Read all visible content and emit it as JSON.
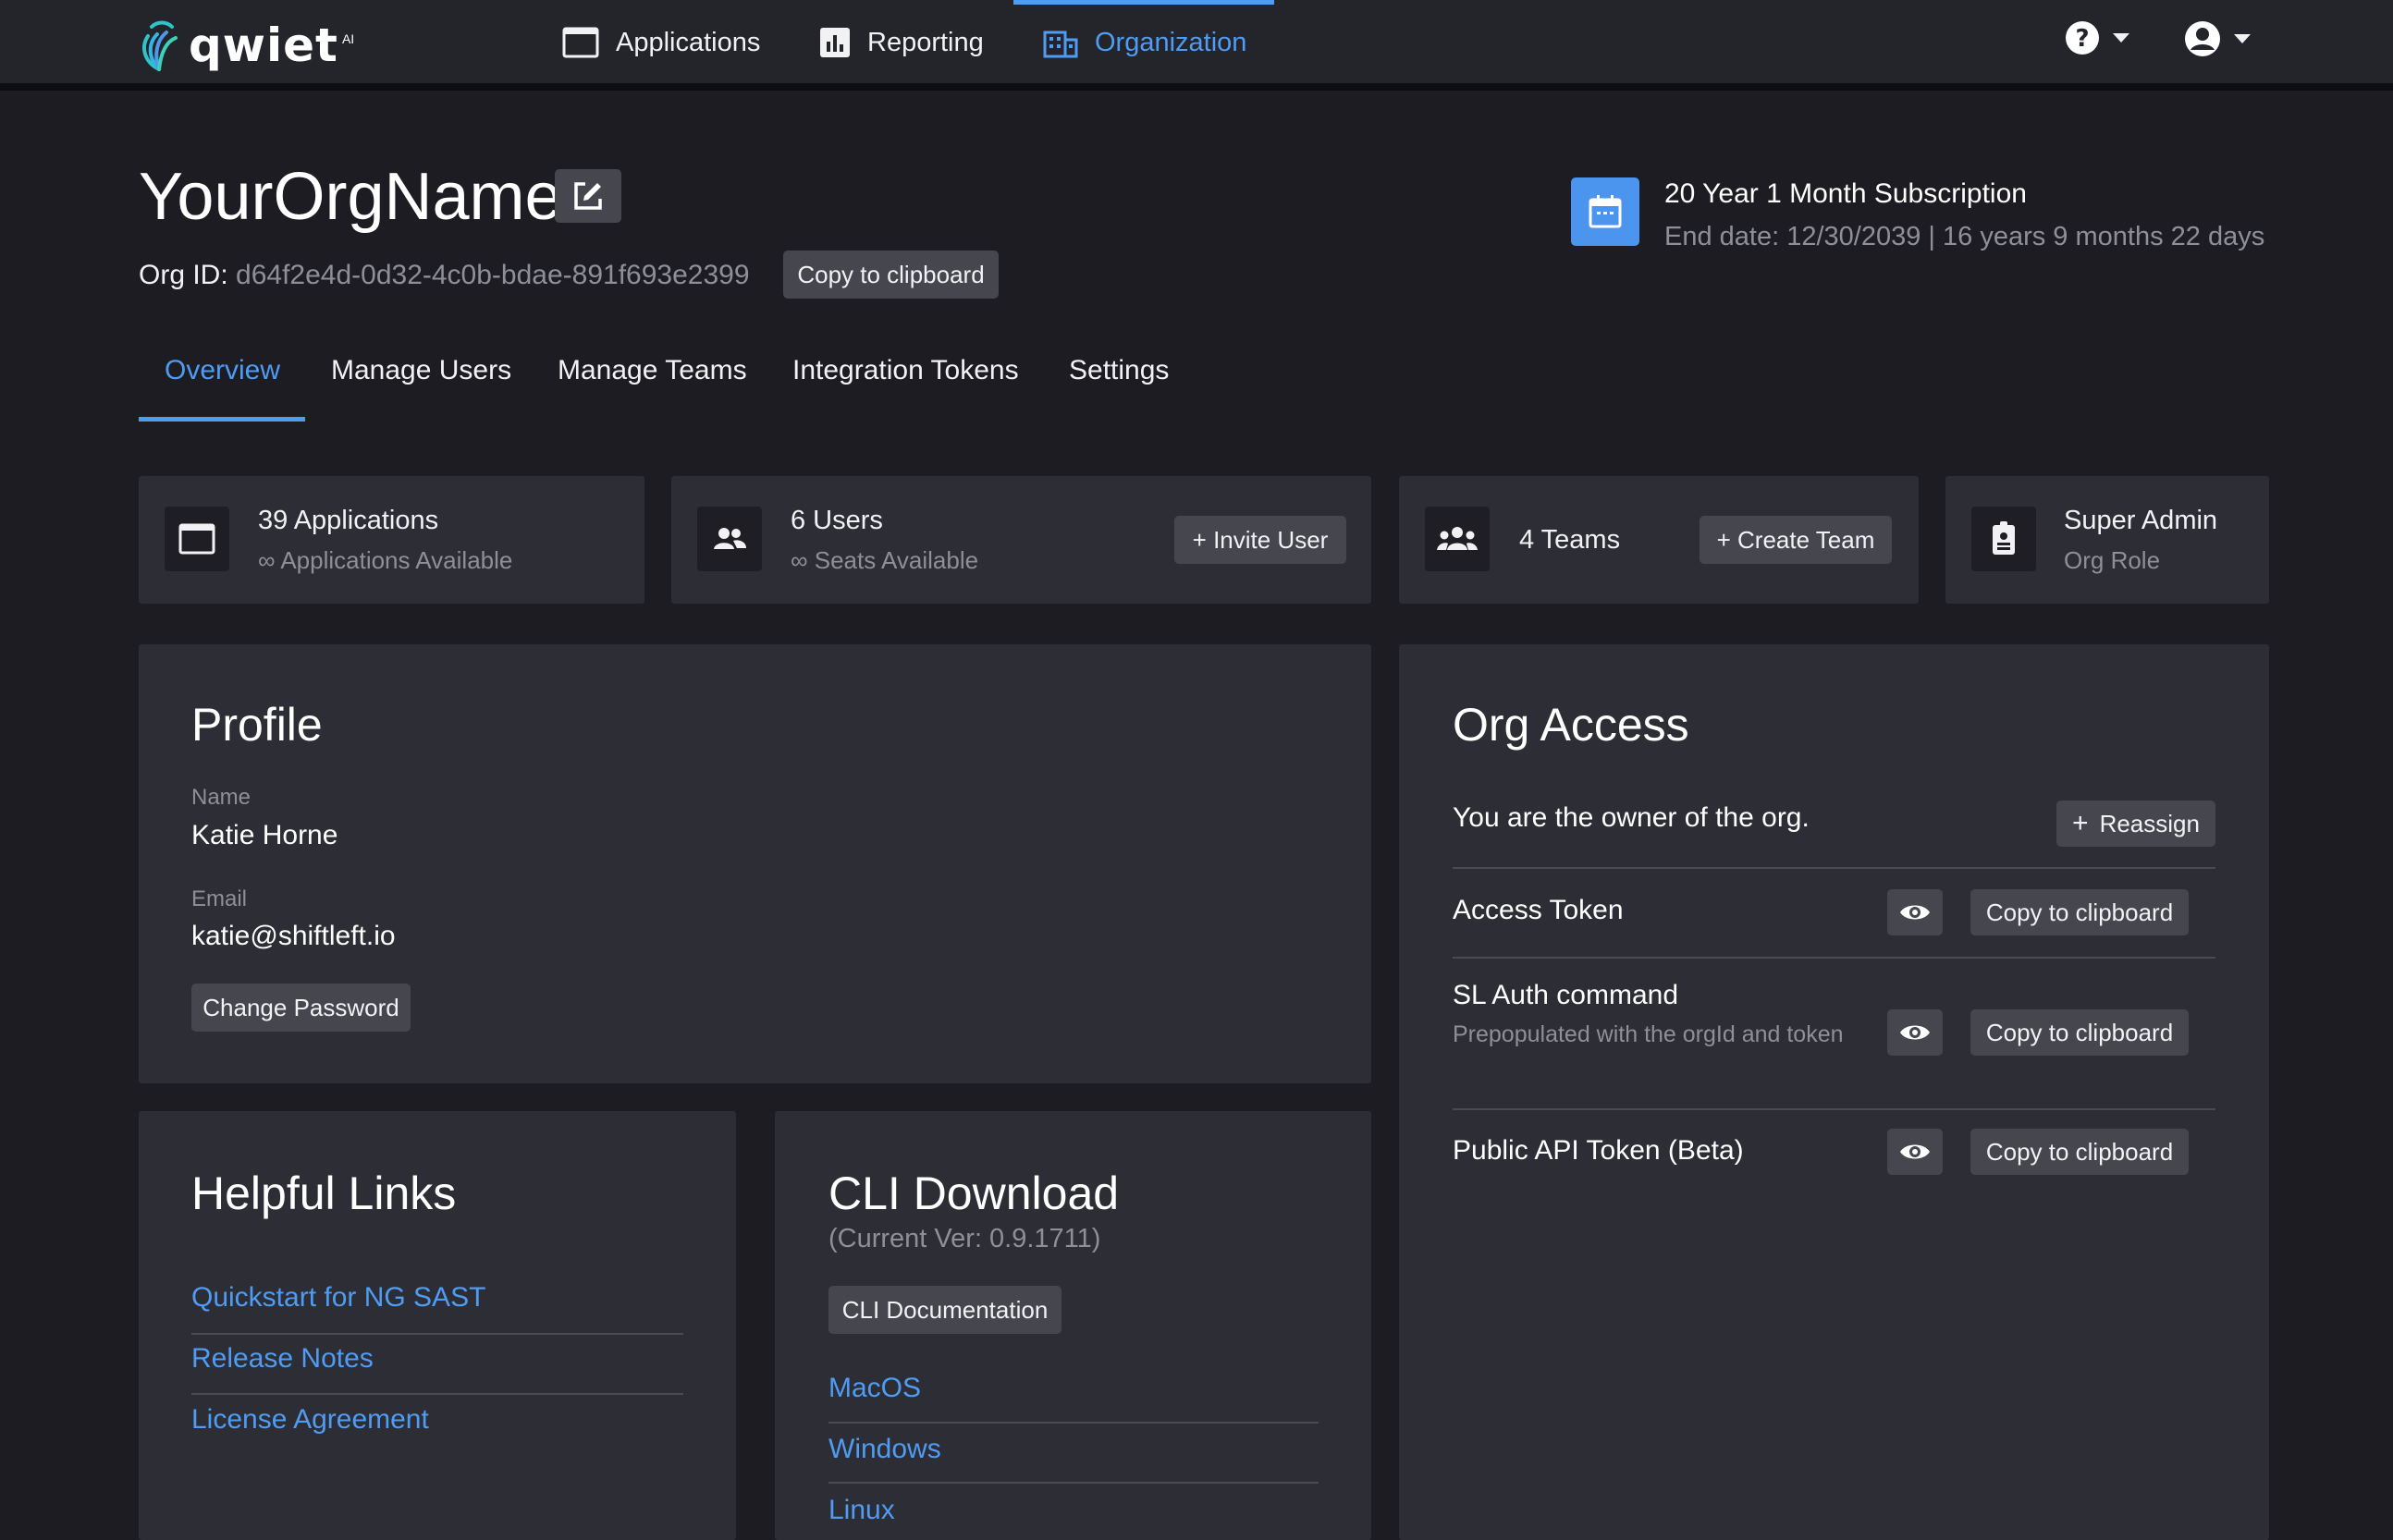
{
  "brand": {
    "logo_text": "qwiet",
    "logo_suffix": "AI"
  },
  "nav": {
    "items": [
      {
        "label": "Applications",
        "icon": "window-icon",
        "active": false
      },
      {
        "label": "Reporting",
        "icon": "bar-chart-icon",
        "active": false
      },
      {
        "label": "Organization",
        "icon": "building-icon",
        "active": true
      }
    ],
    "help_icon": "help-circle-icon",
    "account_icon": "account-circle-icon"
  },
  "org": {
    "name": "YourOrgName",
    "id_label": "Org ID:",
    "id_value": "d64f2e4d-0d32-4c0b-bdae-891f693e2399",
    "copy_label": "Copy to clipboard"
  },
  "subscription": {
    "title": "20 Year 1 Month Subscription",
    "end": "End date: 12/30/2039 | 16 years 9 months 22 days",
    "icon": "calendar-icon"
  },
  "tabs": [
    {
      "label": "Overview",
      "active": true
    },
    {
      "label": "Manage Users",
      "active": false
    },
    {
      "label": "Manage Teams",
      "active": false
    },
    {
      "label": "Integration Tokens",
      "active": false
    },
    {
      "label": "Settings",
      "active": false
    }
  ],
  "stats": {
    "applications": {
      "title": "39 Applications",
      "sub": "∞ Applications Available"
    },
    "users": {
      "title": "6 Users",
      "sub": "∞ Seats Available",
      "button": "+ Invite User"
    },
    "teams": {
      "title": "4 Teams",
      "button": "+ Create Team"
    },
    "role": {
      "title": "Super Admin",
      "sub": "Org Role"
    }
  },
  "profile": {
    "title": "Profile",
    "name_label": "Name",
    "name_value": "Katie Horne",
    "email_label": "Email",
    "email_value": "katie@shiftleft.io",
    "change_password": "Change Password"
  },
  "org_access": {
    "title": "Org Access",
    "owner_text": "You are the owner of the org.",
    "reassign": "Reassign",
    "rows": [
      {
        "label": "Access Token",
        "sub": "",
        "copy": "Copy to clipboard"
      },
      {
        "label": "SL Auth command",
        "sub": "Prepopulated with the orgId and token",
        "copy": "Copy to clipboard"
      },
      {
        "label": "Public API Token (Beta)",
        "sub": "",
        "copy": "Copy to clipboard"
      }
    ]
  },
  "helpful_links": {
    "title": "Helpful Links",
    "links": [
      "Quickstart for NG SAST",
      "Release Notes",
      "License Agreement"
    ]
  },
  "cli": {
    "title": "CLI Download",
    "version": "(Current Ver: 0.9.1711)",
    "docs_button": "CLI Documentation",
    "links": [
      "MacOS",
      "Windows",
      "Linux"
    ]
  },
  "colors": {
    "background": "#1c1c22",
    "card": "#2d2d36",
    "accent": "#4f9cf3",
    "button": "#46464f"
  }
}
